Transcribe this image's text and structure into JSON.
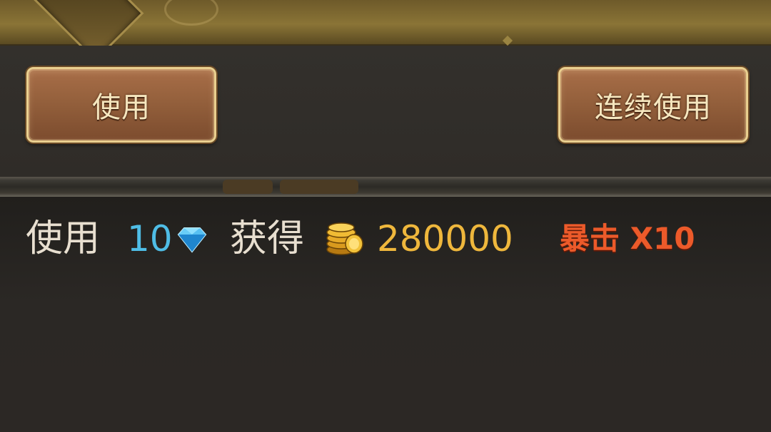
{
  "actions": {
    "use_label": "使用",
    "continuous_use_label": "连续使用"
  },
  "info": {
    "use_label": "使用",
    "cost_value": "10",
    "cost_icon": "diamond-icon",
    "get_label": "获得",
    "gain_icon": "gold-coin-stack-icon",
    "gain_value": "280000",
    "crit_text": "暴击 X10"
  },
  "colors": {
    "cost": "#4fbde6",
    "gain": "#efb73c",
    "crit": "#ec5a2a",
    "button_border": "#e9cf8f"
  }
}
